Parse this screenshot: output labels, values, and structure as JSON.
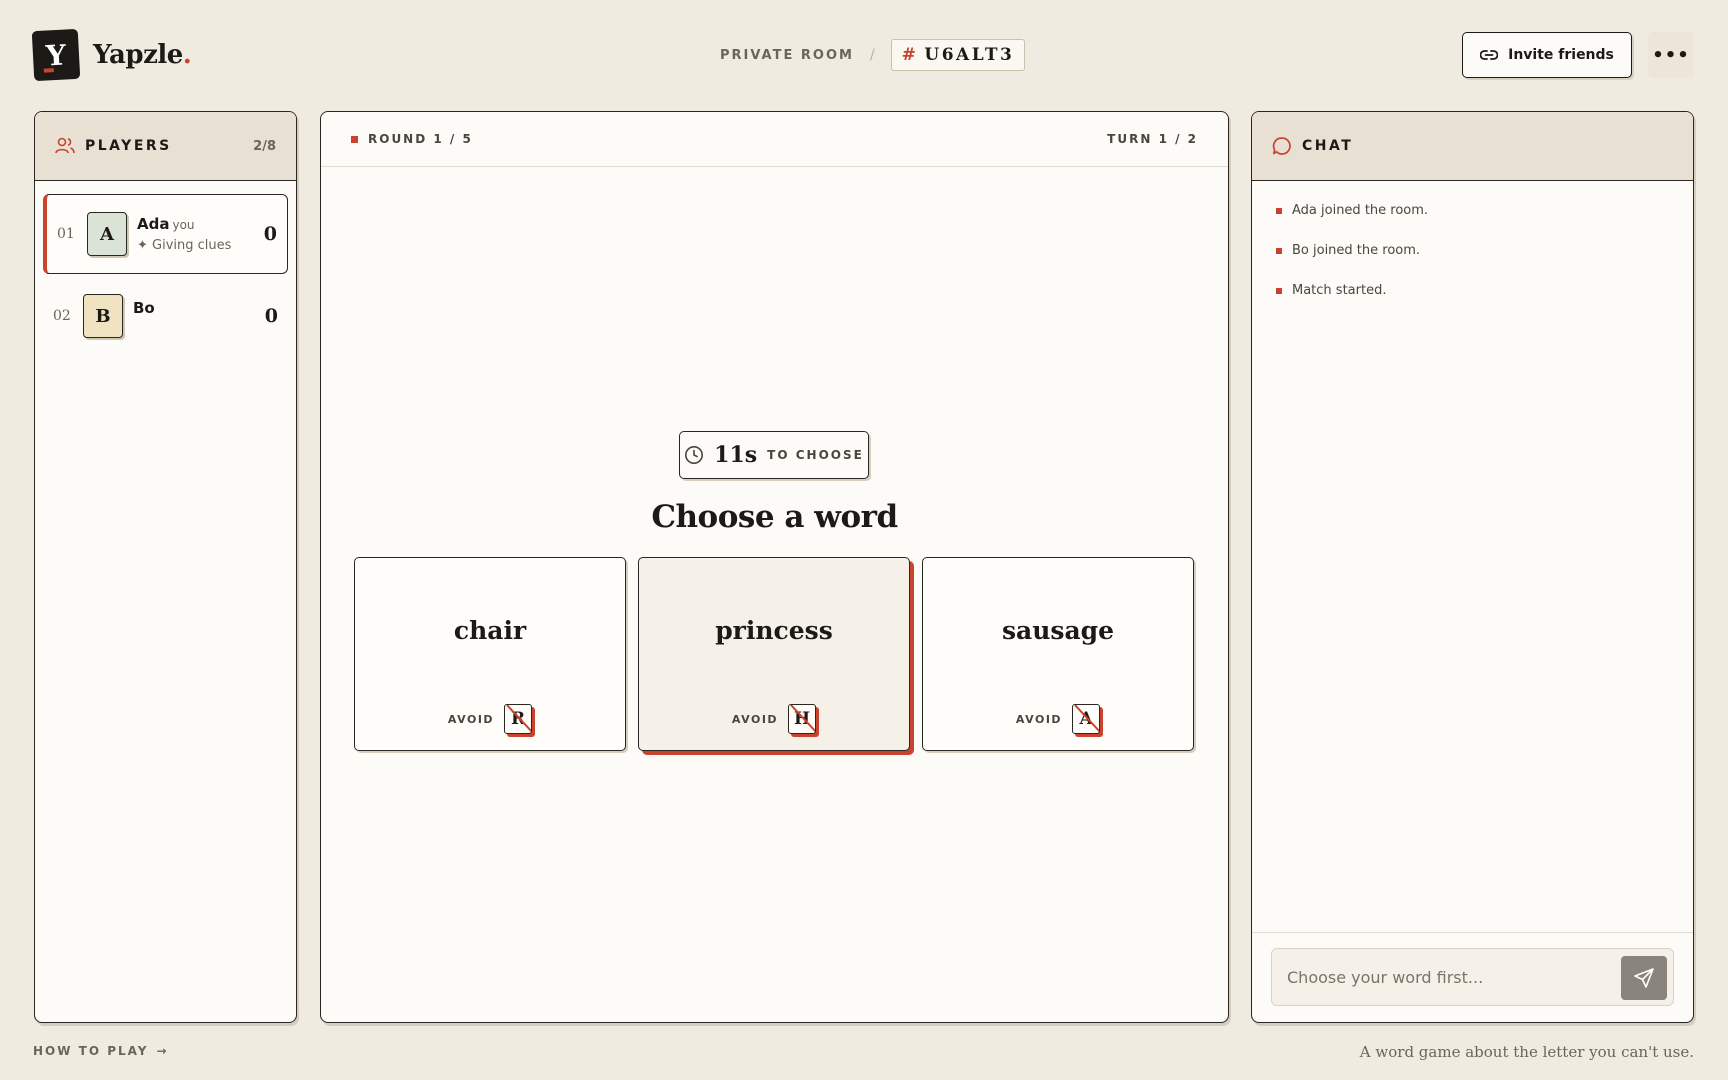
{
  "brand": {
    "name": "Yapzle",
    "dot": ".",
    "logo_letter": "Y"
  },
  "room": {
    "label": "PRIVATE ROOM",
    "separator": "/",
    "hash": "#",
    "code": "U6ALT3"
  },
  "header": {
    "invite_label": "Invite friends",
    "more_label": "•••"
  },
  "players": {
    "title": "PLAYERS",
    "count": "2/8",
    "list": [
      {
        "num": "01",
        "initial": "A",
        "name": "Ada",
        "you": "you",
        "status": "✦ Giving clues",
        "score": "0",
        "avatar_color": "#dbe3d6"
      },
      {
        "num": "02",
        "initial": "B",
        "name": "Bo",
        "you": "",
        "status": "",
        "score": "0",
        "avatar_color": "#efe3c1"
      }
    ]
  },
  "stage": {
    "round": "ROUND 1 / 5",
    "turn": "TURN 1 / 2",
    "timer_value": "11s",
    "timer_label": "TO CHOOSE",
    "title": "Choose a word",
    "avoid_label": "AVOID",
    "words": [
      {
        "word": "chair",
        "avoid": "R"
      },
      {
        "word": "princess",
        "avoid": "H"
      },
      {
        "word": "sausage",
        "avoid": "A"
      }
    ]
  },
  "chat": {
    "title": "CHAT",
    "messages": [
      "Ada joined the room.",
      "Bo joined the room.",
      "Match started."
    ],
    "input_placeholder": "Choose your word first..."
  },
  "footer": {
    "how_to_play": "HOW TO PLAY",
    "arrow": "→",
    "tagline": "A word game about the letter you can't use."
  },
  "colors": {
    "accent": "#c8442f",
    "background": "#f0ebe1",
    "ink": "#1c1a17"
  }
}
